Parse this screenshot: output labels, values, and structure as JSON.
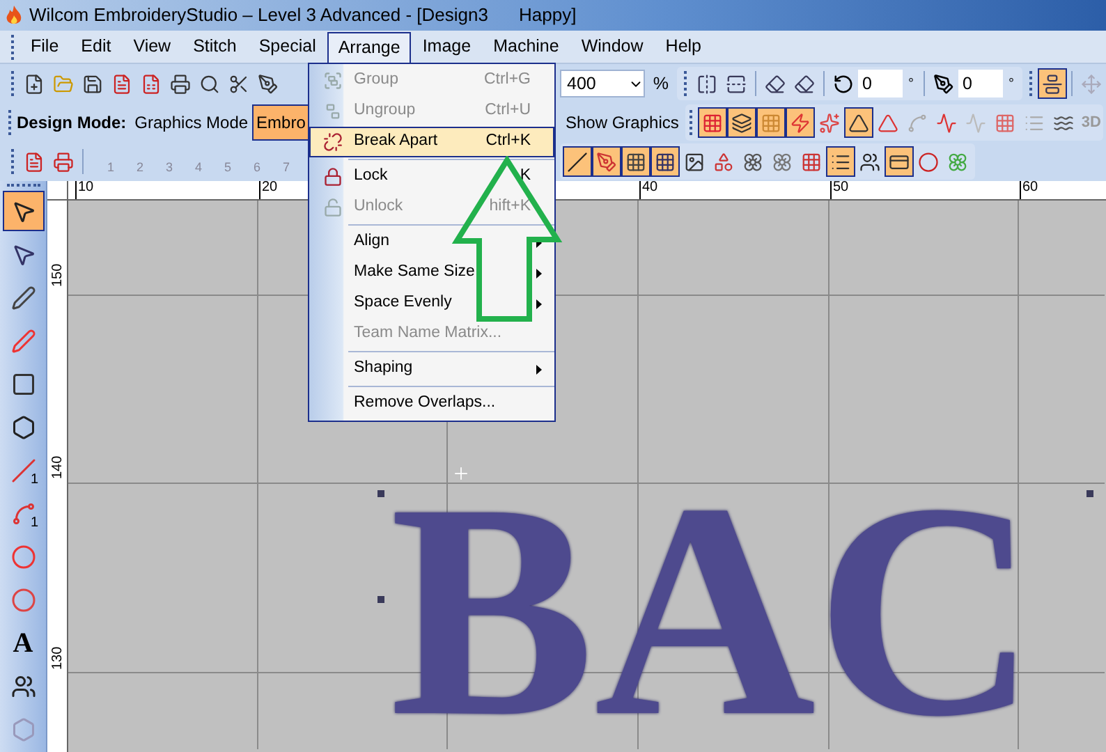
{
  "window": {
    "title": "Wilcom EmbroideryStudio – Level 3 Advanced - [Design3",
    "title_tail": "Happy]"
  },
  "menu_bar": [
    {
      "label": "File",
      "selected": false
    },
    {
      "label": "Edit",
      "selected": false
    },
    {
      "label": "View",
      "selected": false
    },
    {
      "label": "Stitch",
      "selected": false
    },
    {
      "label": "Special",
      "selected": false
    },
    {
      "label": "Arrange",
      "selected": true
    },
    {
      "label": "Image",
      "selected": false
    },
    {
      "label": "Machine",
      "selected": false
    },
    {
      "label": "Window",
      "selected": false
    },
    {
      "label": "Help",
      "selected": false
    }
  ],
  "standard_toolbar": {
    "zoom": {
      "value": "400",
      "unit": "%"
    },
    "rotate": {
      "value": "0",
      "unit": "°"
    },
    "skew": {
      "value": "0",
      "unit": "°"
    },
    "buttons": [
      {
        "selected": true
      },
      {
        "selected": false
      }
    ]
  },
  "mode_toolbar": {
    "label": "Design Mode:",
    "modes": [
      {
        "label": "Graphics Mode",
        "selected": false
      },
      {
        "label": "Embro",
        "selected": true
      },
      {
        "label": "Show Graphics",
        "selected": false
      }
    ],
    "buttons": [
      {
        "selected": true
      },
      {
        "selected": true
      },
      {
        "selected": true
      },
      {
        "selected": true
      },
      {
        "selected": false
      },
      {
        "selected": true
      },
      {
        "selected": false
      },
      {
        "selected": false
      },
      {
        "selected": false
      },
      {
        "selected": false
      },
      {
        "selected": false
      },
      {
        "selected": false
      },
      {
        "selected": false
      }
    ],
    "trailing": "3D"
  },
  "object_toolbar": {
    "numbered": [
      "1",
      "2",
      "3",
      "4",
      "5",
      "6",
      "7"
    ],
    "buttons": [
      {
        "selected": true
      },
      {
        "selected": true
      },
      {
        "selected": true
      },
      {
        "selected": true
      },
      {
        "selected": false
      },
      {
        "selected": false
      },
      {
        "selected": false
      },
      {
        "selected": false
      },
      {
        "selected": false
      },
      {
        "selected": true
      },
      {
        "selected": false
      },
      {
        "selected": true
      },
      {
        "selected": false
      },
      {
        "selected": false
      }
    ]
  },
  "arrange_menu": [
    {
      "kind": "item",
      "label": "Group",
      "shortcut": "Ctrl+G",
      "disabled": true,
      "selected": false
    },
    {
      "kind": "item",
      "label": "Ungroup",
      "shortcut": "Ctrl+U",
      "disabled": true,
      "selected": false
    },
    {
      "kind": "item",
      "label": "Break Apart",
      "shortcut": "Ctrl+K",
      "disabled": false,
      "selected": true
    },
    {
      "kind": "separator"
    },
    {
      "kind": "item",
      "label": "Lock",
      "shortcut": "K",
      "disabled": false,
      "selected": false
    },
    {
      "kind": "item",
      "label": "Unlock",
      "shortcut": "hift+K",
      "disabled": true,
      "selected": false
    },
    {
      "kind": "separator"
    },
    {
      "kind": "submenu",
      "label": "Align",
      "disabled": false,
      "selected": false
    },
    {
      "kind": "submenu",
      "label": "Make Same Size",
      "disabled": false,
      "selected": false
    },
    {
      "kind": "submenu",
      "label": "Space Evenly",
      "disabled": false,
      "selected": false
    },
    {
      "kind": "item",
      "label": "Team Name Matrix...",
      "disabled": true,
      "selected": false
    },
    {
      "kind": "separator"
    },
    {
      "kind": "submenu",
      "label": "Shaping",
      "disabled": false,
      "selected": false
    },
    {
      "kind": "separator"
    },
    {
      "kind": "item",
      "label": "Remove Overlaps...",
      "disabled": false,
      "selected": false
    }
  ],
  "top_ruler": [
    "10",
    "20",
    "40",
    "50",
    "60"
  ],
  "left_ruler": [
    "150",
    "140",
    "130"
  ],
  "toolbox": [
    {
      "selected": true
    },
    {
      "selected": false
    },
    {
      "selected": false
    },
    {
      "selected": false
    },
    {
      "selected": false
    },
    {
      "selected": false
    },
    {
      "selected": false,
      "label": "1"
    },
    {
      "selected": false,
      "label": "1"
    },
    {
      "selected": false
    },
    {
      "selected": false
    },
    {
      "selected": false,
      "label": "A"
    },
    {
      "selected": false
    },
    {
      "selected": false
    }
  ],
  "canvas": {
    "design_text": "BAC"
  }
}
